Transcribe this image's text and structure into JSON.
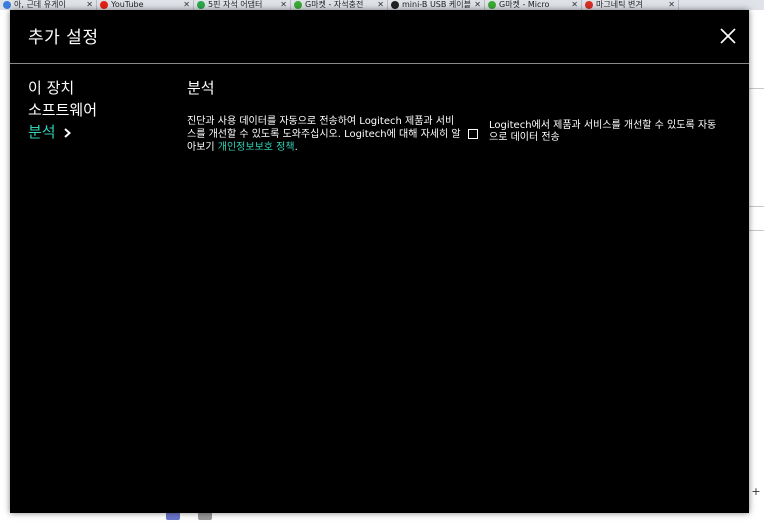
{
  "browser": {
    "tabs": [
      {
        "title": "아, 근데 유게이",
        "color": "#3b7ddd"
      },
      {
        "title": "YouTube",
        "color": "#e62117"
      },
      {
        "title": "5핀 자석 어댑터",
        "color": "#2aa84a"
      },
      {
        "title": "G마켓 - 자석충전",
        "color": "#3aaa35"
      },
      {
        "title": "mini-B USB 케이블",
        "color": "#222222"
      },
      {
        "title": "G마켓 - Micro",
        "color": "#3aaa35"
      },
      {
        "title": "마그네틱 변겨",
        "color": "#d93025"
      }
    ],
    "tab_close": "✕",
    "scroll_plus": "+"
  },
  "modal": {
    "title": "추가 설정",
    "close_label": "✕",
    "nav": [
      {
        "label": "이 장치"
      },
      {
        "label": "소프트웨어"
      },
      {
        "label": "분석",
        "active": true
      }
    ],
    "section": {
      "title": "분석",
      "description": "진단과 사용 데이터를 자동으로 전송하여 Logitech 제품과 서비스를 개선할 수 있도록 도와주십시오. Logitech에 대해 자세히 알아보기 ",
      "privacy_link": "개인정보보호 정책",
      "description_end": ".",
      "checkbox_label": "Logitech에서 제품과 서비스를 개선할 수 있도록 자동으로 데이터 전송",
      "checkbox_checked": false
    },
    "accent_color": "#2fd0b5"
  }
}
